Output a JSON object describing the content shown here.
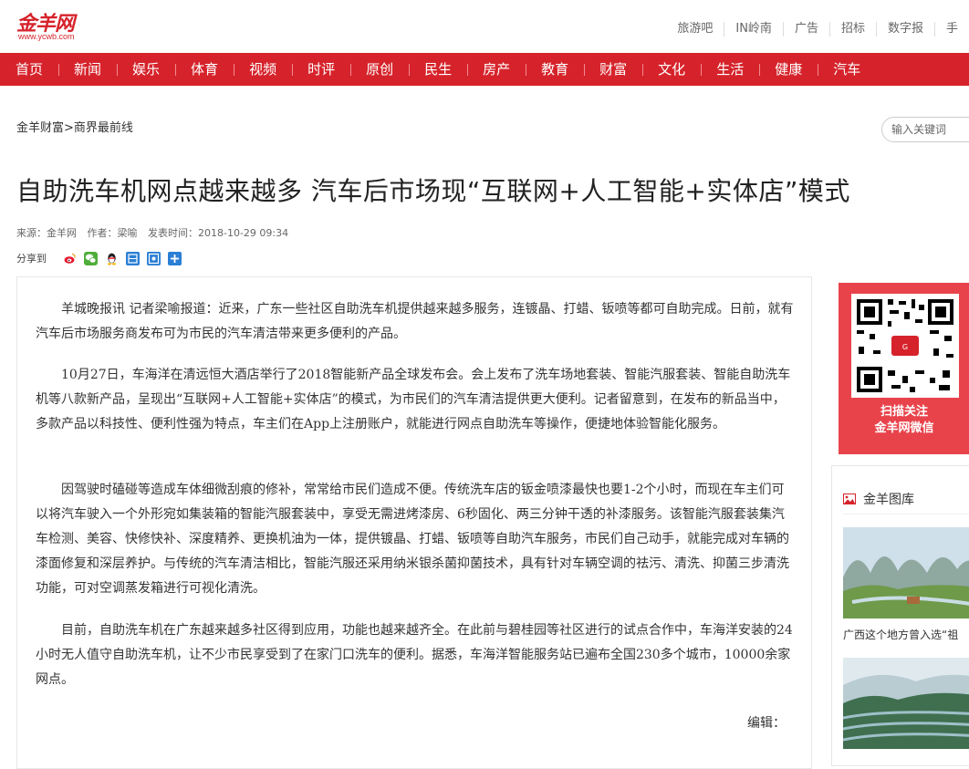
{
  "header": {
    "logo_text": "金羊网",
    "logo_url": "www.ycwb.com",
    "top_links": [
      "旅游吧",
      "IN岭南",
      "广告",
      "招标",
      "数字报",
      "手"
    ]
  },
  "nav": {
    "items": [
      "首页",
      "新闻",
      "娱乐",
      "体育",
      "视频",
      "时评",
      "原创",
      "民生",
      "房产",
      "教育",
      "财富",
      "文化",
      "生活",
      "健康",
      "汽车"
    ]
  },
  "breadcrumb": "金羊财富>商界最前线",
  "search": {
    "placeholder": "输入关键词"
  },
  "article": {
    "title": "自助洗车机网点越来越多 汽车后市场现“互联网+人工智能+实体店”模式",
    "source": "来源：金羊网",
    "author": "作者：梁喻",
    "time": "发表时间：2018-10-29 09:34",
    "share_label": "分享到",
    "paragraphs": [
      "羊城晚报讯 记者梁喻报道：近来，广东一些社区自助洗车机提供越来越多服务，连镀晶、打蜡、钣喷等都可自助完成。日前，就有汽车后市场服务商发布可为市民的汽车清洁带来更多便利的产品。",
      "10月27日，车海洋在清远恒大酒店举行了2018智能新产品全球发布会。会上发布了洗车场地套装、智能汽服套装、智能自助洗车机等八款新产品，呈现出“互联网+人工智能+实体店”的模式，为市民们的汽车清洁提供更大便利。记者留意到，在发布的新品当中，多款产品以科技性、便利性强为特点，车主们在App上注册账户，就能进行网点自助洗车等操作，便捷地体验智能化服务。",
      "因驾驶时磕碰等造成车体细微刮痕的修补，常常给市民们造成不便。传统洗车店的钣金喷漆最快也要1-2个小时，而现在车主们可以将汽车驶入一个外形宛如集装箱的智能汽服套装中，享受无需进烤漆房、6秒固化、两三分钟干透的补漆服务。该智能汽服套装集汽车检测、美容、快修快补、深度精养、更换机油为一体，提供镀晶、打蜡、钣喷等自助汽车服务，市民们自己动手，就能完成对车辆的漆面修复和深层养护。与传统的汽车清洁相比，智能汽服还采用纳米银杀菌抑菌技术，具有针对车辆空调的祛污、清洗、抑菌三步清洗功能，可对空调蒸发箱进行可视化清洗。",
      "目前，自助洗车机在广东越来越多社区得到应用，功能也越来越齐全。在此前与碧桂园等社区进行的试点合作中，车海洋安装的24小时无人值守自助洗车机，让不少市民享受到了在家门口洗车的便利。据悉，车海洋智能服务站已遍布全国230多个城市，10000余家网点。"
    ],
    "editor": "编辑："
  },
  "sidebar": {
    "qr_line1": "扫描关注",
    "qr_line2": "金羊网微信",
    "gallery_title": "金羊图库",
    "gallery_caption": "广西这个地方曾入选“祖"
  },
  "colors": {
    "brand_red": "#d6232b",
    "qr_bg": "#e8434b"
  }
}
